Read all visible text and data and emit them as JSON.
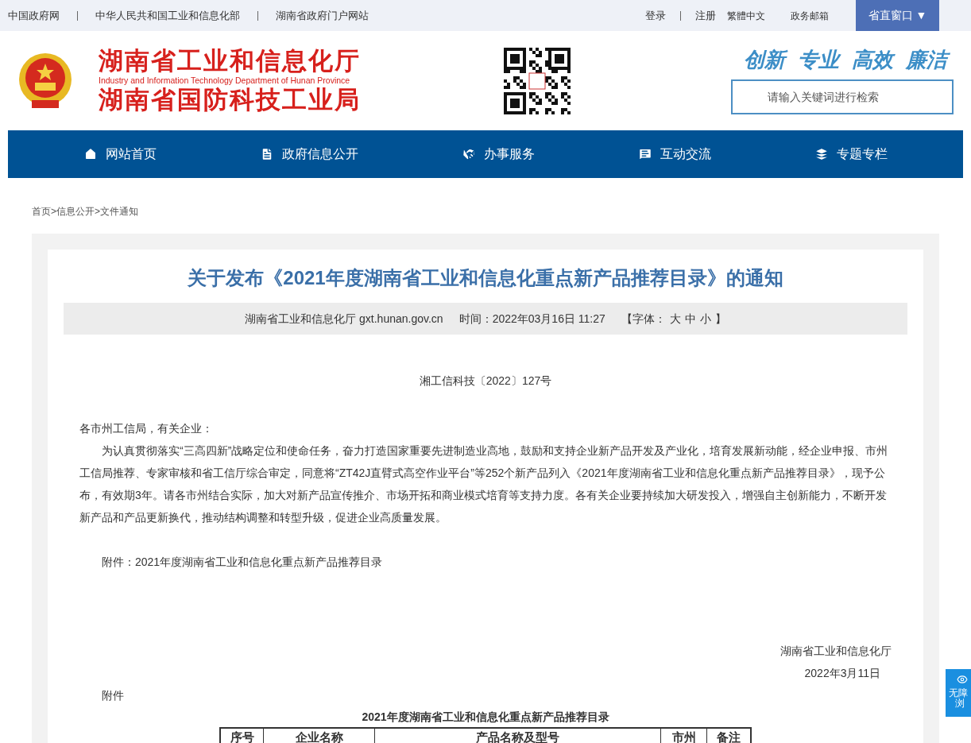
{
  "top_bar": {
    "links": [
      "中国政府网",
      "中华人民共和国工业和信息化部",
      "湖南省政府门户网站"
    ],
    "right_links": [
      "登录",
      "注册",
      "繁體中文",
      "政务邮箱"
    ],
    "window_button": "省直窗口 ▼"
  },
  "header": {
    "title_1": "湖南省工业和信息化厅",
    "subtitle": "Industry and Information Technology Department of Hunan Province",
    "title_2": "湖南省国防科技工业局",
    "slogan": [
      "创新",
      "专业",
      "高效",
      "廉洁"
    ],
    "search": {
      "placeholder": "请输入关键词进行检索"
    }
  },
  "nav": [
    {
      "kind": "home",
      "label": "网站首页"
    },
    {
      "kind": "doc",
      "label": "政府信息公开"
    },
    {
      "kind": "handshake",
      "label": "办事服务"
    },
    {
      "kind": "chat",
      "label": "互动交流"
    },
    {
      "kind": "layers",
      "label": "专题专栏"
    }
  ],
  "breadcrumb": [
    "首页",
    ">",
    "信息公开",
    ">",
    "文件通知"
  ],
  "article": {
    "title": "关于发布《2021年度湖南省工业和信息化重点新产品推荐目录》的通知",
    "meta": {
      "source": "湖南省工业和信息化厅 gxt.hunan.gov.cn",
      "time": "时间：2022年03月16日 11:27",
      "font_label": "【字体：",
      "font_sizes": [
        "大",
        "中",
        "小"
      ],
      "font_end": "】"
    },
    "doc_number": "湘工信科技〔2022〕127号",
    "salutation": "各市州工信局，有关企业：",
    "paragraph": "为认真贯彻落实“三高四新”战略定位和使命任务，奋力打造国家重要先进制造业高地，鼓励和支持企业新产品开发及产业化，培育发展新动能，经企业申报、市州工信局推荐、专家审核和省工信厅综合审定，同意将“ZT42J直臂式高空作业平台”等252个新产品列入《2021年度湖南省工业和信息化重点新产品推荐目录》，现予公布，有效期3年。请各市州结合实际，加大对新产品宣传推介、市场开拓和商业模式培育等支持力度。各有关企业要持续加大研发投入，增强自主创新能力，不断开发新产品和产品更新换代，推动结构调整和转型升级，促进企业高质量发展。",
    "attachment": "附件：2021年度湖南省工业和信息化重点新产品推荐目录",
    "signature": "湖南省工业和信息化厅",
    "date": "2022年3月11日",
    "appendix_label": "附件",
    "table": {
      "title": "2021年度湖南省工业和信息化重点新产品推荐目录",
      "columns": [
        "序号",
        "企业名称",
        "产品名称及型号",
        "市州",
        "备注"
      ]
    }
  },
  "accessibility": {
    "lines": [
      "无障",
      "浏"
    ]
  }
}
